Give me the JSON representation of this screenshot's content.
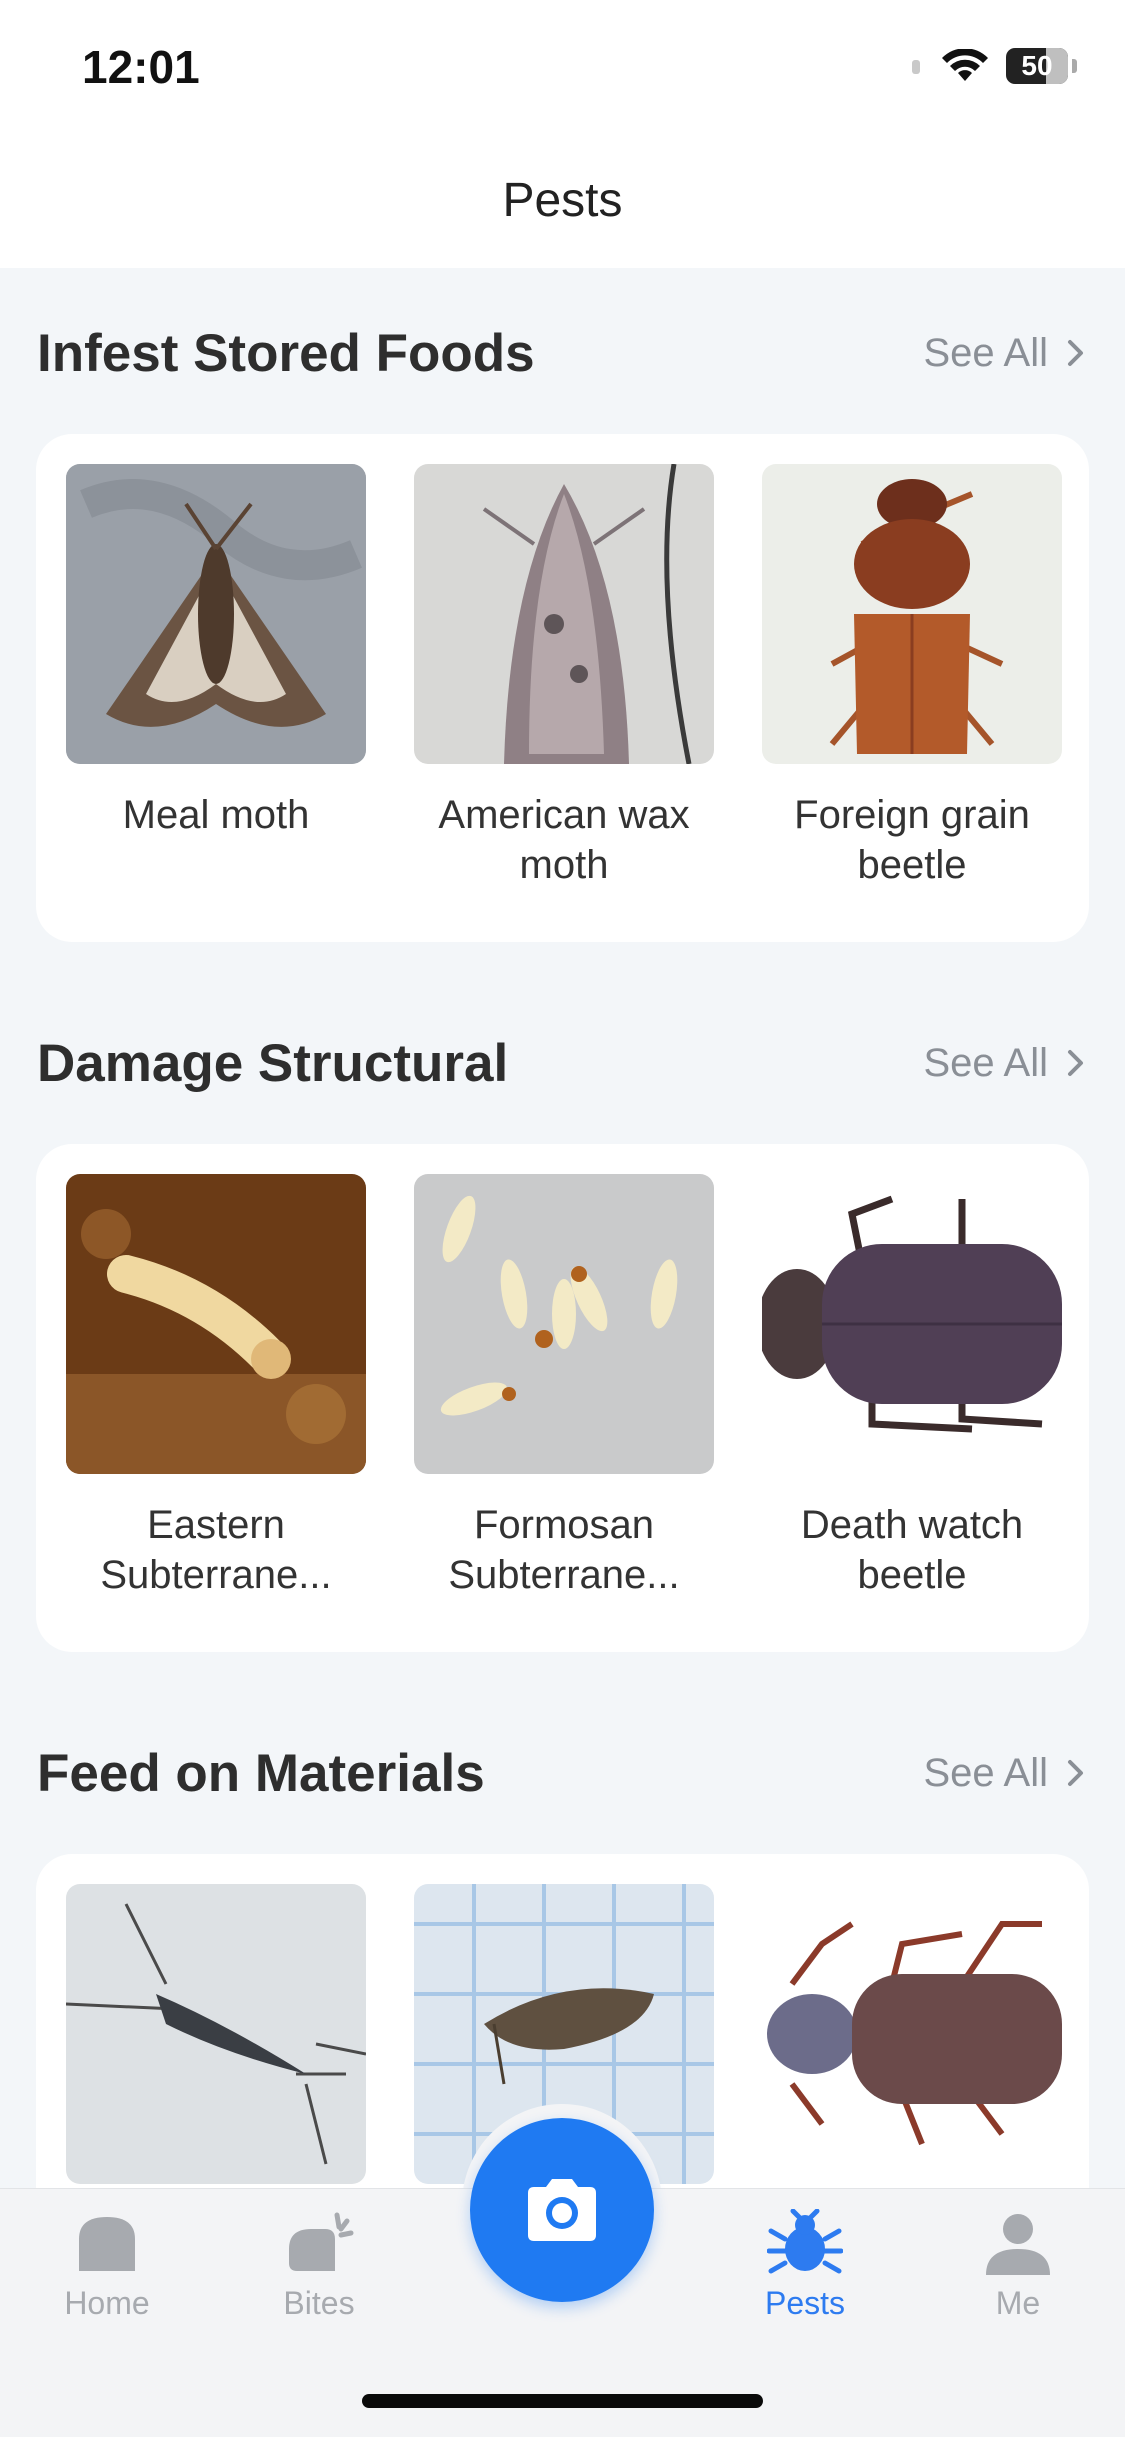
{
  "status": {
    "time": "12:01",
    "battery": "50"
  },
  "header": {
    "title": "Pests"
  },
  "sections": [
    {
      "title": "Infest Stored Foods",
      "see_all": "See All",
      "items": [
        {
          "label": "Meal moth"
        },
        {
          "label": "American wax moth"
        },
        {
          "label": "Foreign grain beetle"
        }
      ]
    },
    {
      "title": "Damage Structural",
      "see_all": "See All",
      "items": [
        {
          "label": "Eastern Subterrane..."
        },
        {
          "label": "Formosan Subterrane..."
        },
        {
          "label": "Death watch beetle"
        }
      ]
    },
    {
      "title": "Feed on Materials",
      "see_all": "See All",
      "items": [
        {
          "label": ""
        },
        {
          "label": ""
        },
        {
          "label": ""
        }
      ]
    }
  ],
  "tabs": [
    {
      "label": "Home",
      "icon": "home-icon",
      "active": false
    },
    {
      "label": "Bites",
      "icon": "bites-icon",
      "active": false
    },
    {
      "label": "",
      "icon": "camera-icon",
      "active": false
    },
    {
      "label": "Pests",
      "icon": "bug-icon",
      "active": true
    },
    {
      "label": "Me",
      "icon": "person-icon",
      "active": false
    }
  ],
  "colors": {
    "accent": "#1f7af2",
    "tab_inactive": "#a7aaaf",
    "background": "#f3f6f9"
  }
}
